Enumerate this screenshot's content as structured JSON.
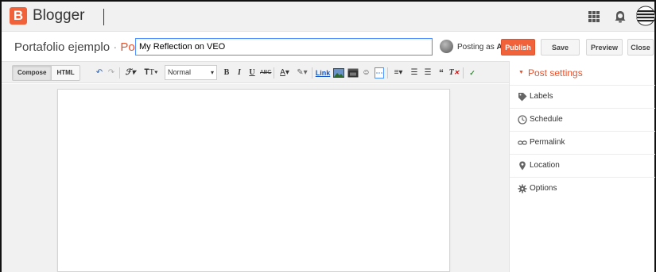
{
  "app": {
    "name": "Blogger",
    "logo_letter": "B"
  },
  "header": {
    "blog_name": "Portafolio ejemplo",
    "separator": "·",
    "section": "Post",
    "post_title": "My Reflection on VEO",
    "posting_as_prefix": "Posting as",
    "posting_as_user": "A",
    "buttons": {
      "publish": "Publish",
      "save": "Save",
      "preview": "Preview",
      "close": "Close"
    }
  },
  "toolbar": {
    "tabs": [
      "Compose",
      "HTML"
    ],
    "active_tab": "Compose",
    "format_value": "Normal",
    "link_label": "Link"
  },
  "sidebar": {
    "title": "Post settings",
    "items": [
      {
        "label": "Labels",
        "icon": "tag-icon"
      },
      {
        "label": "Schedule",
        "icon": "clock-icon"
      },
      {
        "label": "Permalink",
        "icon": "link-icon"
      },
      {
        "label": "Location",
        "icon": "location-pin-icon"
      },
      {
        "label": "Options",
        "icon": "gear-icon"
      }
    ]
  },
  "colors": {
    "accent": "#f1623b",
    "link": "#1155cc",
    "focus": "#4d90fe"
  }
}
